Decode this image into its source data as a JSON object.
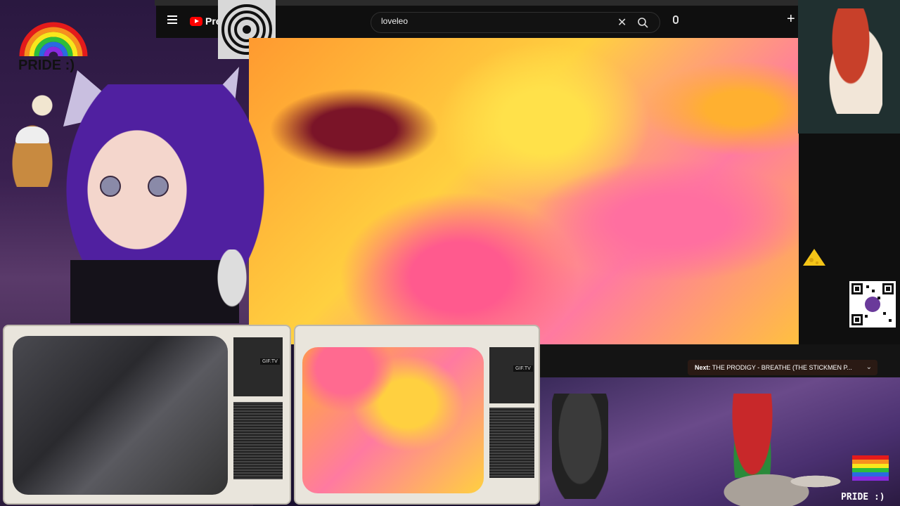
{
  "youtube": {
    "brand": "Pre",
    "search": {
      "value": "loveleo",
      "placeholder": "Search"
    }
  },
  "next_up": {
    "prefix": "Next:",
    "title": "THE PRODIGY - BREATHE (THE STICKMEN P..."
  },
  "overlays": {
    "tv1_label": "GIF.TV",
    "tv2_label": "GIF.TV",
    "pride_label": "PRIDE :)",
    "pride_corner": "PRIDE :)"
  },
  "colors": {
    "yt_red": "#ff0000",
    "topbar": "#0f0f0f",
    "tv_body": "#e9e5dc"
  },
  "icons": [
    "hamburger-icon",
    "search-icon",
    "clear-icon",
    "mic-icon",
    "create-icon",
    "chevron-down-icon"
  ]
}
